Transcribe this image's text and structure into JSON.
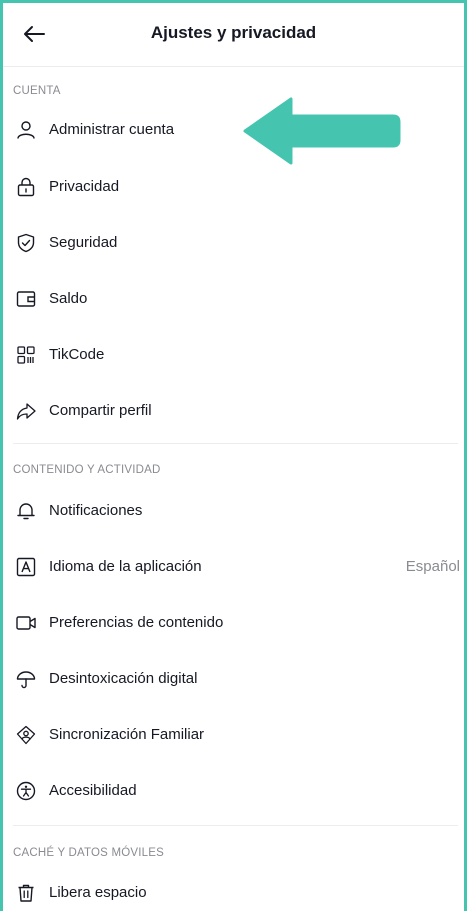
{
  "header": {
    "title": "Ajustes y privacidad",
    "back_icon": "arrow-left-icon"
  },
  "sections": [
    {
      "title": "CUENTA",
      "items": [
        {
          "label": "Administrar cuenta",
          "icon": "user-icon"
        },
        {
          "label": "Privacidad",
          "icon": "lock-icon"
        },
        {
          "label": "Seguridad",
          "icon": "shield-icon"
        },
        {
          "label": "Saldo",
          "icon": "wallet-icon"
        },
        {
          "label": "TikCode",
          "icon": "qr-code-icon"
        },
        {
          "label": "Compartir perfil",
          "icon": "share-icon"
        }
      ]
    },
    {
      "title": "CONTENIDO Y ACTIVIDAD",
      "items": [
        {
          "label": "Notificaciones",
          "icon": "bell-icon"
        },
        {
          "label": "Idioma de la aplicación",
          "icon": "language-icon",
          "value": "Español"
        },
        {
          "label": "Preferencias de contenido",
          "icon": "video-icon"
        },
        {
          "label": "Desintoxicación digital",
          "icon": "umbrella-icon"
        },
        {
          "label": "Sincronización Familiar",
          "icon": "family-pairing-icon"
        },
        {
          "label": "Accesibilidad",
          "icon": "accessibility-icon"
        }
      ]
    },
    {
      "title": "CACHÉ Y DATOS MÓVILES",
      "items": [
        {
          "label": "Libera espacio",
          "icon": "trash-icon"
        }
      ]
    }
  ],
  "annotation": {
    "arrow_color": "#45c4b0"
  },
  "colors": {
    "frame_border": "#45c4b0",
    "text": "#161823",
    "muted": "#8a8b91"
  }
}
